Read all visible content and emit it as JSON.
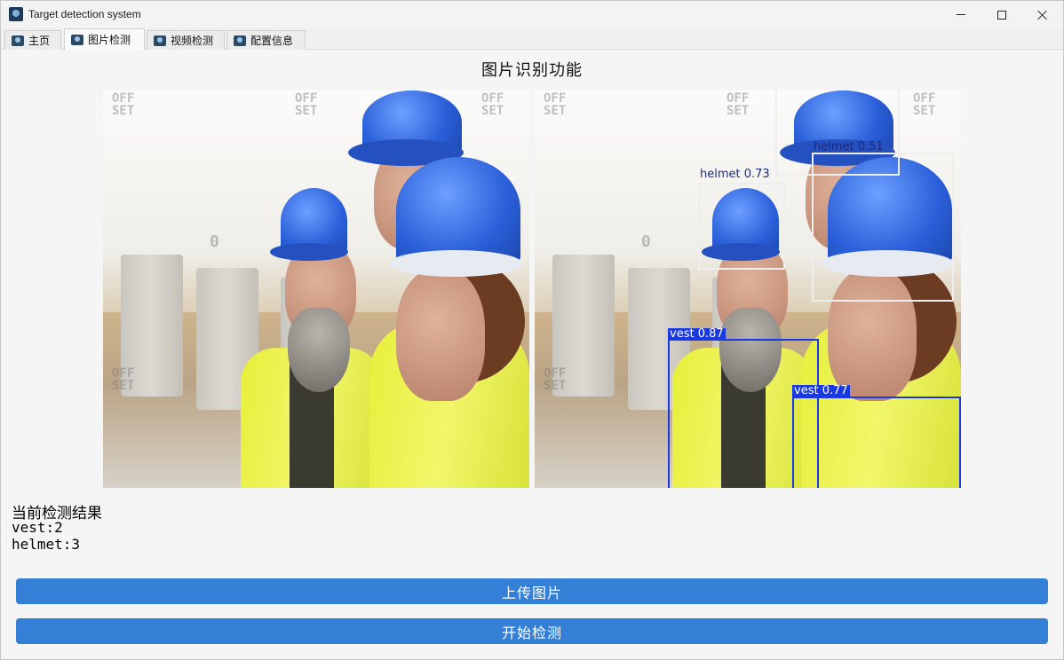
{
  "window": {
    "title": "Target detection system"
  },
  "tabs": [
    {
      "label": "主页",
      "icon": "app-icon"
    },
    {
      "label": "图片检测",
      "icon": "app-icon",
      "active": true
    },
    {
      "label": "视频检测",
      "icon": "app-icon"
    },
    {
      "label": "配置信息",
      "icon": "app-icon"
    }
  ],
  "main": {
    "title": "图片识别功能",
    "watermark": {
      "line1": "OFF",
      "line2": "SET",
      "center": "0"
    },
    "detections": [
      {
        "label": "helmet 0.51",
        "color": "#eeeeee"
      },
      {
        "label": "helmet 0.73",
        "color": "#eeeeee"
      },
      {
        "label": "vest 0.87",
        "color": "#1a3ae0"
      },
      {
        "label": "vest 0.77",
        "color": "#1a3ae0"
      }
    ],
    "results": {
      "heading": "当前检测结果",
      "lines": [
        "vest:2",
        "helmet:3"
      ]
    },
    "buttons": {
      "upload": "上传图片",
      "start": "开始检测"
    }
  },
  "colors": {
    "accent": "#3380d6",
    "helmet_blue": "#2a5fd9",
    "vest_yellow": "#e6ef3a"
  }
}
